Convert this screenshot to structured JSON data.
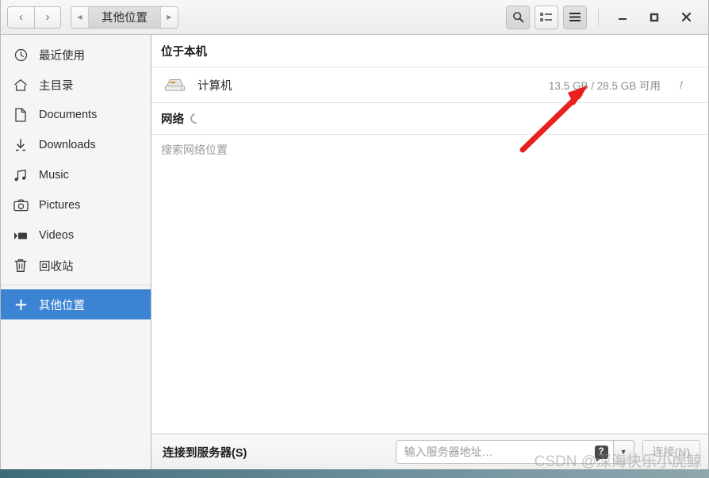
{
  "window": {
    "nav": {
      "back": "‹",
      "forward": "›",
      "back_name": "back",
      "forward_name": "forward"
    },
    "breadcrumb": {
      "left_arrow": "◀",
      "label": "其他位置",
      "right_arrow": "▶"
    },
    "toolbar": {
      "search": "search-icon",
      "list_view": "list-view-icon",
      "menu": "hamburger-menu-icon"
    },
    "controls": {
      "minimize": "–",
      "maximize": "□",
      "close": "✕"
    }
  },
  "sidebar": {
    "items": [
      {
        "label": "最近使用",
        "icon": "clock-icon"
      },
      {
        "label": "主目录",
        "icon": "home-icon"
      },
      {
        "label": "Documents",
        "icon": "document-icon"
      },
      {
        "label": "Downloads",
        "icon": "download-icon"
      },
      {
        "label": "Music",
        "icon": "music-icon"
      },
      {
        "label": "Pictures",
        "icon": "camera-icon"
      },
      {
        "label": "Videos",
        "icon": "video-icon"
      },
      {
        "label": "回收站",
        "icon": "trash-icon"
      }
    ],
    "other_locations": {
      "label": "其他位置",
      "icon": "plus-icon",
      "selected": true
    }
  },
  "main": {
    "section_title": "位于本机",
    "places": [
      {
        "name": "计算机",
        "icon": "hard-drive-icon",
        "free": "13.5 GB / 28.5 GB 可用",
        "mount": "/"
      }
    ],
    "network": {
      "title": "网络",
      "loading": true,
      "empty_text": "搜索网络位置"
    }
  },
  "actionbar": {
    "connect_label": "连接到服务器(S)",
    "address_placeholder": "输入服务器地址…",
    "address_value": "",
    "help_icon": "help-icon",
    "dropdown_icon": "chevron-down-icon",
    "connect_button": "连接(N)"
  },
  "watermark": {
    "text": "CSDN @深海快乐小虎鲸"
  },
  "colors": {
    "accent": "#3c84d3",
    "arrow": "#e8201f",
    "sidebar_bg": "#f5f5f4"
  }
}
